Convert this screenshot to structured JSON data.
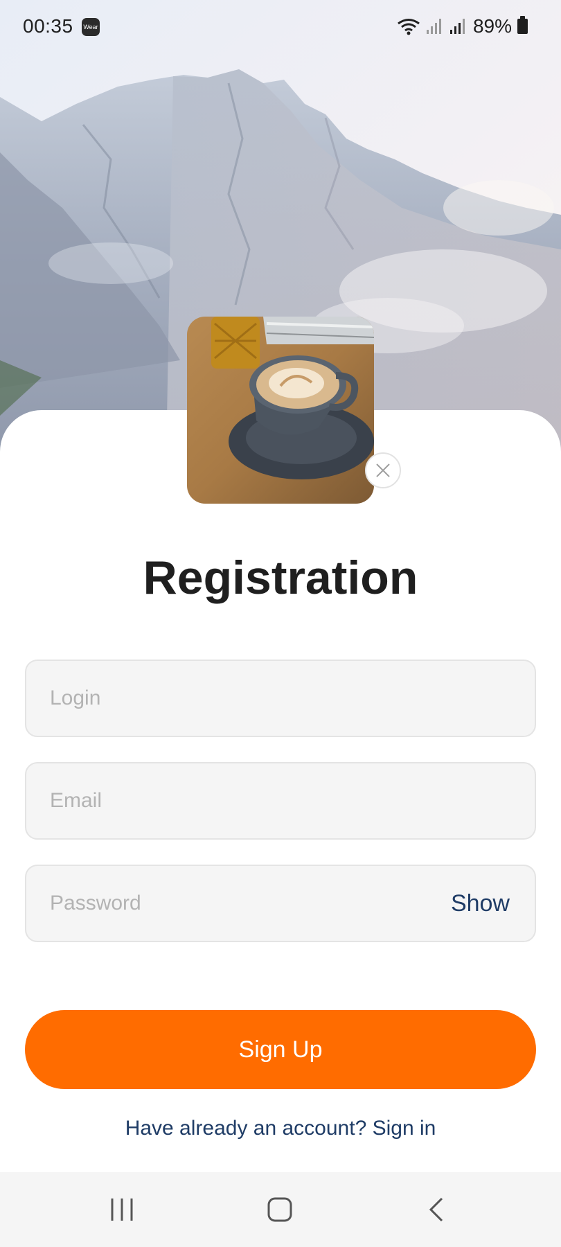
{
  "status_bar": {
    "time": "00:35",
    "wear_badge": "Wear",
    "battery_percent": "89%"
  },
  "form": {
    "title": "Registration",
    "login_placeholder": "Login",
    "email_placeholder": "Email",
    "password_placeholder": "Password",
    "show_label": "Show",
    "signup_label": "Sign Up",
    "signin_text": "Have already an account? Sign in"
  },
  "colors": {
    "accent": "#ff6c00",
    "link": "#1f3c66",
    "field_bg": "#f5f5f5"
  },
  "icons": {
    "remove_avatar": "close-icon",
    "nav_recent": "recent-apps-icon",
    "nav_home": "home-icon",
    "nav_back": "back-icon"
  }
}
